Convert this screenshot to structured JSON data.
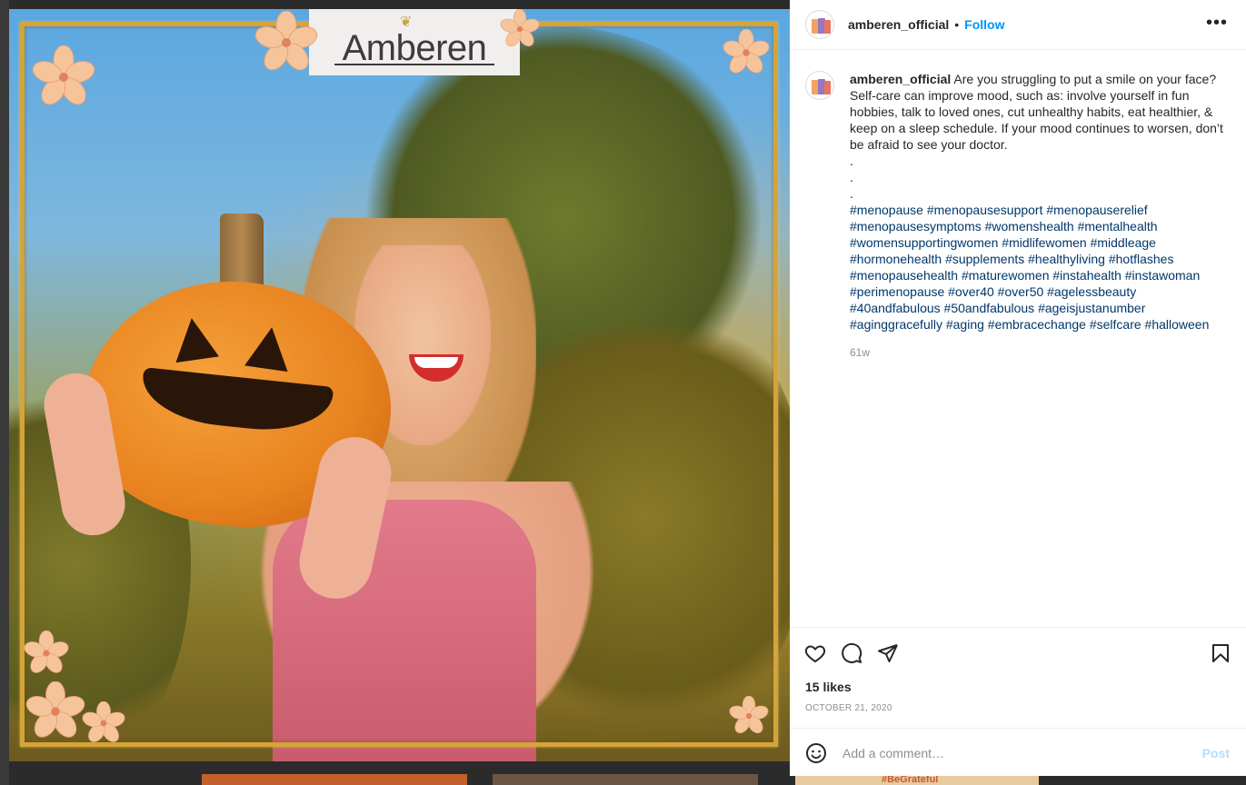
{
  "post": {
    "username": "amberen_official",
    "follow_label": "Follow",
    "separator": "•",
    "more_label": "•••",
    "logo_text": "Amberen",
    "caption_text": "Are you struggling to put a smile on your face? Self-care can improve mood, such as: involve yourself in fun hobbies, talk to loved ones, cut unhealthy habits, eat healthier, & keep on a sleep schedule. If your mood continues to worsen, don’t be afraid to see your doctor.\n.\n.\n.",
    "hashtags": "#menopause #menopausesupport #menopauserelief #menopausesymptoms #womenshealth #mentalhealth #womensupportingwomen #midlifewomen #middleage #hormonehealth #supplements #healthyliving #hotflashes #menopausehealth #maturewomen #instahealth #instawoman #perimenopause #over40 #over50 #agelessbeauty #40andfabulous #50andfabulous #ageisjustanumber #aginggracefully #aging #embracechange #selfcare #halloween",
    "age": "61w",
    "likes": "15 likes",
    "date": "OCTOBER 21, 2020"
  },
  "comment": {
    "placeholder": "Add a comment…",
    "post_label": "Post"
  },
  "background": {
    "tile_text": "#BeGrateful"
  },
  "colors": {
    "link_blue": "#0095f6",
    "hashtag_blue": "#00376b",
    "muted": "#8e8e8e",
    "post_disabled": "#b2dffc"
  }
}
